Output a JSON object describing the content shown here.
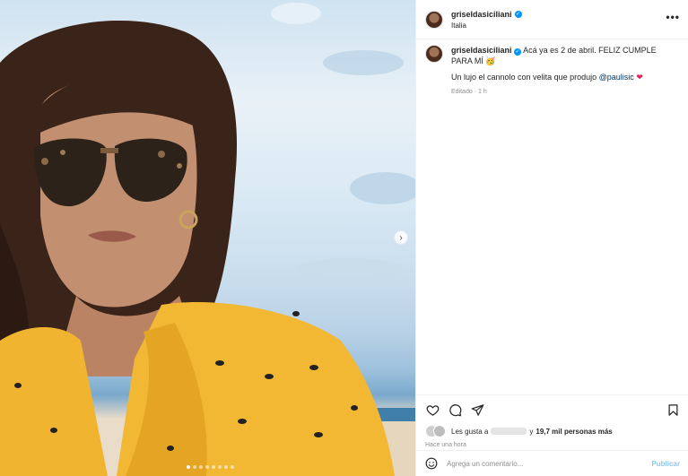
{
  "post": {
    "username": "griseldasiciliani",
    "verified_mark": "✓",
    "location": "Italia",
    "more_label": "•••"
  },
  "caption": {
    "username": "griseldasiciliani",
    "text1": "Acá ya es 2 de abril. FELIZ CUMPLE PARA MÍ",
    "prefix_emoji": "🇮🇹",
    "suffix_emoji": "🥳",
    "text2": "Un lujo el cannolo con velita que produjo",
    "mention": "@paulisic",
    "heart": "❤",
    "edited": "Editado",
    "age": "1 h"
  },
  "actions": {
    "like_icon": "heart-icon",
    "comment_icon": "comment-icon",
    "share_icon": "share-icon",
    "save_icon": "bookmark-icon",
    "likes_prefix": "Les gusta a",
    "likes_suffix": "y",
    "likes_count": "19,7 mil personas más",
    "time_ago": "Hace una hora"
  },
  "comment": {
    "placeholder": "Agrega un comentario...",
    "publish_label": "Publicar"
  },
  "carousel": {
    "slides": 8,
    "active_index": 0,
    "next_label": "›"
  }
}
